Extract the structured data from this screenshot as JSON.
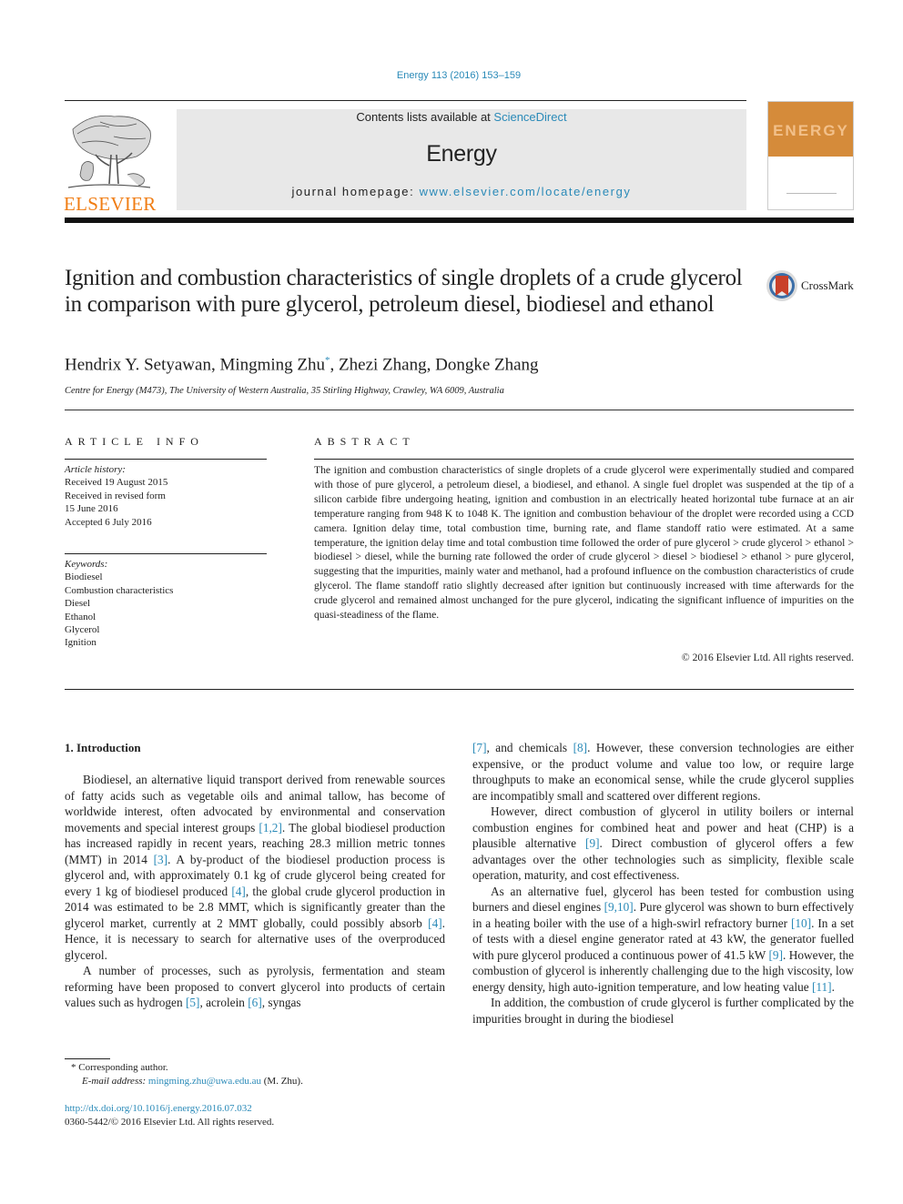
{
  "header": {
    "citation": "Energy 113 (2016) 153–159",
    "contents_prefix": "Contents lists available at ",
    "contents_link": "ScienceDirect",
    "journal_name": "Energy",
    "homepage_prefix": "journal homepage: ",
    "homepage_link": "www.elsevier.com/locate/energy",
    "publisher_logo_text": "ELSEVIER",
    "cover_title": "ENERGY",
    "brand_orange": "#f07d14",
    "link_color": "#2a8ab8"
  },
  "article": {
    "title": "Ignition and combustion characteristics of single droplets of a crude glycerol in comparison with pure glycerol, petroleum diesel, biodiesel and ethanol",
    "crossmark_label": "CrossMark",
    "authors": [
      {
        "name": "Hendrix Y. Setyawan",
        "sep": ", "
      },
      {
        "name": "Mingming Zhu",
        "mark": "*",
        "sep": ", "
      },
      {
        "name": "Zhezi Zhang",
        "sep": ", "
      },
      {
        "name": "Dongke Zhang",
        "sep": ""
      }
    ],
    "affiliation": "Centre for Energy (M473), The University of Western Australia, 35 Stirling Highway, Crawley, WA 6009, Australia"
  },
  "article_info": {
    "heading": "ARTICLE INFO",
    "history_label": "Article history:",
    "history": [
      "Received 19 August 2015",
      "Received in revised form",
      "15 June 2016",
      "Accepted 6 July 2016"
    ],
    "keywords_label": "Keywords:",
    "keywords": [
      "Biodiesel",
      "Combustion characteristics",
      "Diesel",
      "Ethanol",
      "Glycerol",
      "Ignition"
    ]
  },
  "abstract": {
    "heading": "ABSTRACT",
    "text": "The ignition and combustion characteristics of single droplets of a crude glycerol were experimentally studied and compared with those of pure glycerol, a petroleum diesel, a biodiesel, and ethanol. A single fuel droplet was suspended at the tip of a silicon carbide fibre undergoing heating, ignition and combustion in an electrically heated horizontal tube furnace at an air temperature ranging from 948 K to 1048 K. The ignition and combustion behaviour of the droplet were recorded using a CCD camera. Ignition delay time, total combustion time, burning rate, and flame standoff ratio were estimated. At a same temperature, the ignition delay time and total combustion time followed the order of pure glycerol > crude glycerol > ethanol > biodiesel > diesel, while the burning rate followed the order of crude glycerol > diesel > biodiesel > ethanol > pure glycerol, suggesting that the impurities, mainly water and methanol, had a profound influence on the combustion characteristics of crude glycerol. The flame standoff ratio slightly decreased after ignition but continuously increased with time afterwards for the crude glycerol and remained almost unchanged for the pure glycerol, indicating the significant influence of impurities on the quasi-steadiness of the flame.",
    "copyright": "© 2016 Elsevier Ltd. All rights reserved."
  },
  "introduction": {
    "heading": "1.  Introduction",
    "left_paragraphs": [
      [
        {
          "t": "Biodiesel, an alternative liquid transport derived from renewable sources of fatty acids such as vegetable oils and animal tallow, has become of worldwide interest, often advocated by environmental and conservation movements and special interest groups "
        },
        {
          "ref": "[1,2]"
        },
        {
          "t": ". The global biodiesel production has increased rapidly in recent years, reaching 28.3 million metric tonnes (MMT) in 2014 "
        },
        {
          "ref": "[3]"
        },
        {
          "t": ". A by-product of the biodiesel production process is glycerol and, with approximately 0.1 kg of crude glycerol being created for every 1 kg of biodiesel produced "
        },
        {
          "ref": "[4]"
        },
        {
          "t": ", the global crude glycerol production in 2014 was estimated to be 2.8 MMT, which is significantly greater than the glycerol market, currently at 2 MMT globally, could possibly absorb "
        },
        {
          "ref": "[4]"
        },
        {
          "t": ". Hence, it is necessary to search for alternative uses of the overproduced glycerol."
        }
      ],
      [
        {
          "t": "A number of processes, such as pyrolysis, fermentation and steam reforming have been proposed to convert glycerol into products of certain values such as hydrogen "
        },
        {
          "ref": "[5]"
        },
        {
          "t": ", acrolein "
        },
        {
          "ref": "[6]"
        },
        {
          "t": ", syngas"
        }
      ]
    ],
    "right_paragraphs": [
      [
        {
          "ref": "[7]"
        },
        {
          "t": ", and chemicals "
        },
        {
          "ref": "[8]"
        },
        {
          "t": ". However, these conversion technologies are either expensive, or the product volume and value too low, or require large throughputs to make an economical sense, while the crude glycerol supplies are incompatibly small and scattered over different regions."
        }
      ],
      [
        {
          "t": "However, direct combustion of glycerol in utility boilers or internal combustion engines for combined heat and power and heat (CHP) is a plausible alternative "
        },
        {
          "ref": "[9]"
        },
        {
          "t": ". Direct combustion of glycerol offers a few advantages over the other technologies such as simplicity, flexible scale operation, maturity, and cost effectiveness."
        }
      ],
      [
        {
          "t": "As an alternative fuel, glycerol has been tested for combustion using burners and diesel engines "
        },
        {
          "ref": "[9,10]"
        },
        {
          "t": ". Pure glycerol was shown to burn effectively in a heating boiler with the use of a high-swirl refractory burner "
        },
        {
          "ref": "[10]"
        },
        {
          "t": ". In a set of tests with a diesel engine generator rated at 43 kW, the generator fuelled with pure glycerol produced a continuous power of 41.5 kW "
        },
        {
          "ref": "[9]"
        },
        {
          "t": ". However, the combustion of glycerol is inherently challenging due to the high viscosity, low energy density, high auto-ignition temperature, and low heating value "
        },
        {
          "ref": "[11]"
        },
        {
          "t": "."
        }
      ],
      [
        {
          "t": "In addition, the combustion of crude glycerol is further complicated by the impurities brought in during the biodiesel"
        }
      ]
    ]
  },
  "footnote": {
    "mark": "*",
    "corresponding": "Corresponding author.",
    "email_label": "E-mail address: ",
    "email": "mingming.zhu@uwa.edu.au",
    "email_suffix": " (M. Zhu)."
  },
  "doi": {
    "url": "http://dx.doi.org/10.1016/j.energy.2016.07.032",
    "issn_line": "0360-5442/© 2016 Elsevier Ltd. All rights reserved."
  }
}
